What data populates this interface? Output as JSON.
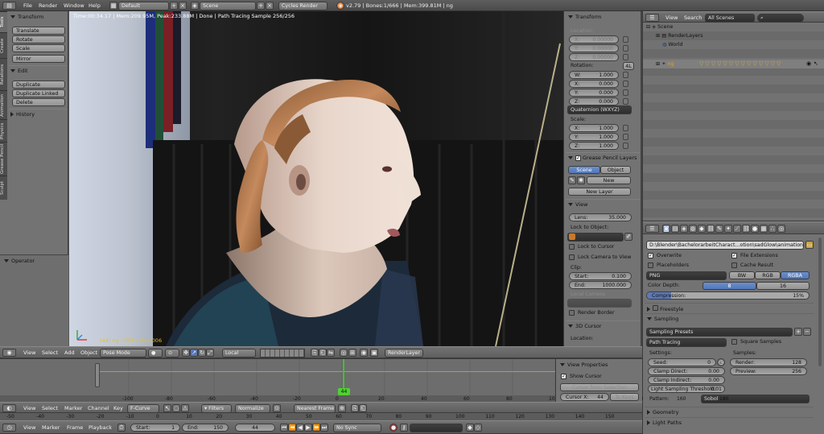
{
  "topbar": {
    "menus": [
      "File",
      "Render",
      "Window",
      "Help"
    ],
    "layout": "Default",
    "scene": "Scene",
    "engine": "Cycles Render",
    "stats": "v2.79 | Bones:1/666 | Mem:399.81M | ng"
  },
  "toolshelf": {
    "tabs": [
      "Tools",
      "Create",
      "Relations",
      "Animation",
      "Physics",
      "Grease Pencil",
      "Sculpt"
    ],
    "transform_header": "Transform",
    "transform_buttons": [
      "Translate",
      "Rotate",
      "Scale"
    ],
    "mirror": "Mirror",
    "edit_header": "Edit",
    "edit_buttons": [
      "Duplicate",
      "Duplicate Linked",
      "Delete"
    ],
    "history_header": "History",
    "operator_header": "Operator"
  },
  "viewport": {
    "render_status": "Time:00:34.17 | Mem:209.95M, Peak:233.88M | Done | Path Tracing Sample 256/256",
    "object_label": "(44) ng : DEF-spine.006"
  },
  "viewport_header": {
    "menus": [
      "View",
      "Select",
      "Add",
      "Object"
    ],
    "mode": "Pose Mode",
    "orientation": "Local",
    "renderlayer": "RenderLayer"
  },
  "npanel": {
    "transform_header": "Transform",
    "location_label": "Location:",
    "location": [
      {
        "axis": "X:",
        "value": "0.00000"
      },
      {
        "axis": "Y:",
        "value": "0.00000"
      },
      {
        "axis": "Z:",
        "value": "0.00000"
      }
    ],
    "rotation_label": "Rotation:",
    "rotation_mode_badge": "4L",
    "rotation": [
      {
        "axis": "W:",
        "value": "1.000"
      },
      {
        "axis": "X:",
        "value": "0.000"
      },
      {
        "axis": "Y:",
        "value": "0.000"
      },
      {
        "axis": "Z:",
        "value": "0.000"
      }
    ],
    "rotation_mode": "Quaternion (WXYZ)",
    "scale_label": "Scale:",
    "scale": [
      {
        "axis": "X:",
        "value": "1.000"
      },
      {
        "axis": "Y:",
        "value": "1.000"
      },
      {
        "axis": "Z:",
        "value": "1.000"
      }
    ],
    "gp_header": "Grease Pencil Layers",
    "gp_scene": "Scene",
    "gp_object": "Object",
    "gp_new": "New",
    "gp_new_layer": "New Layer",
    "view_header": "View",
    "lens_label": "Lens:",
    "lens_value": "35.000",
    "lock_object_label": "Lock to Object:",
    "lock_cursor": "Lock to Cursor",
    "lock_camera": "Lock Camera to View",
    "clip_label": "Clip:",
    "clip_start_label": "Start:",
    "clip_start": "0.100",
    "clip_end_label": "End:",
    "clip_end": "1000.000",
    "local_camera": "Local Camera",
    "render_border": "Render Border",
    "cursor_header": "3D Cursor",
    "cursor_location": "Location:"
  },
  "outliner": {
    "menus": [
      "View",
      "Search"
    ],
    "filter": "All Scenes",
    "items": [
      {
        "label": "Scene",
        "indent": 0
      },
      {
        "label": "RenderLayers",
        "indent": 1
      },
      {
        "label": "World",
        "indent": 1
      },
      {
        "label": "ng",
        "indent": 1
      }
    ]
  },
  "properties": {
    "output_path": "D:\\Blender\\BachelorarbeitCharact...otion\\sadGlow\\animation\\images\\",
    "overwrite": "Overwrite",
    "file_extensions": "File Extensions",
    "placeholders": "Placeholders",
    "cache_result": "Cache Result",
    "format": "PNG",
    "color_modes": [
      "BW",
      "RGB",
      "RGBA"
    ],
    "color_depth_label": "Color Depth:",
    "color_depths": [
      "8",
      "16"
    ],
    "compression_label": "Compression:",
    "compression_value": "15%",
    "compression_fraction": 0.15,
    "freestyle": "Freestyle",
    "sampling": "Sampling",
    "sampling_presets": "Sampling Presets",
    "integrator": "Path Tracing",
    "square_samples": "Square Samples",
    "settings_label": "Settings:",
    "samples_label": "Samples:",
    "seed_label": "Seed:",
    "seed": "0",
    "clamp_direct_label": "Clamp Direct:",
    "clamp_direct": "0.00",
    "clamp_indirect_label": "Clamp Indirect:",
    "clamp_indirect": "0.00",
    "lst_label": "Light Sampling Threshold:",
    "lst": "0.01",
    "render_label": "Render:",
    "render_samples": "128",
    "preview_label": "Preview:",
    "preview_samples": "256",
    "pattern_label": "Pattern:",
    "pattern": "Sobol",
    "geometry": "Geometry",
    "light_paths": "Light Paths"
  },
  "timeline_panel": {
    "header": "View Properties",
    "show_cursor": "Show Cursor",
    "cursor_from_selection": "Cursor from Selection",
    "cursor_x_label": "Cursor X:",
    "cursor_x": "44",
    "to_keys": "To Keys"
  },
  "dopesheet": {
    "ruler": [
      "-100",
      "-80",
      "-60",
      "-40",
      "-20",
      "0",
      "20",
      "40",
      "60",
      "80",
      "100",
      "120",
      "140",
      "160",
      "180"
    ],
    "current_frame": "44",
    "menus": [
      "View",
      "Select",
      "Marker",
      "Channel",
      "Key"
    ],
    "mode": "F-Curve",
    "filters": "Filters",
    "normalize": "Normalize",
    "interp": "Nearest Frame"
  },
  "timeline": {
    "ruler": [
      "-50",
      "-40",
      "-30",
      "-20",
      "-10",
      "0",
      "10",
      "20",
      "30",
      "40",
      "50",
      "60",
      "70",
      "80",
      "90",
      "100",
      "110",
      "120",
      "130",
      "140",
      "150"
    ],
    "menus": [
      "View",
      "Marker",
      "Frame",
      "Playback"
    ],
    "start_label": "Start:",
    "start": "1",
    "end_label": "End:",
    "end": "150",
    "frame": "44",
    "sync": "No Sync"
  }
}
